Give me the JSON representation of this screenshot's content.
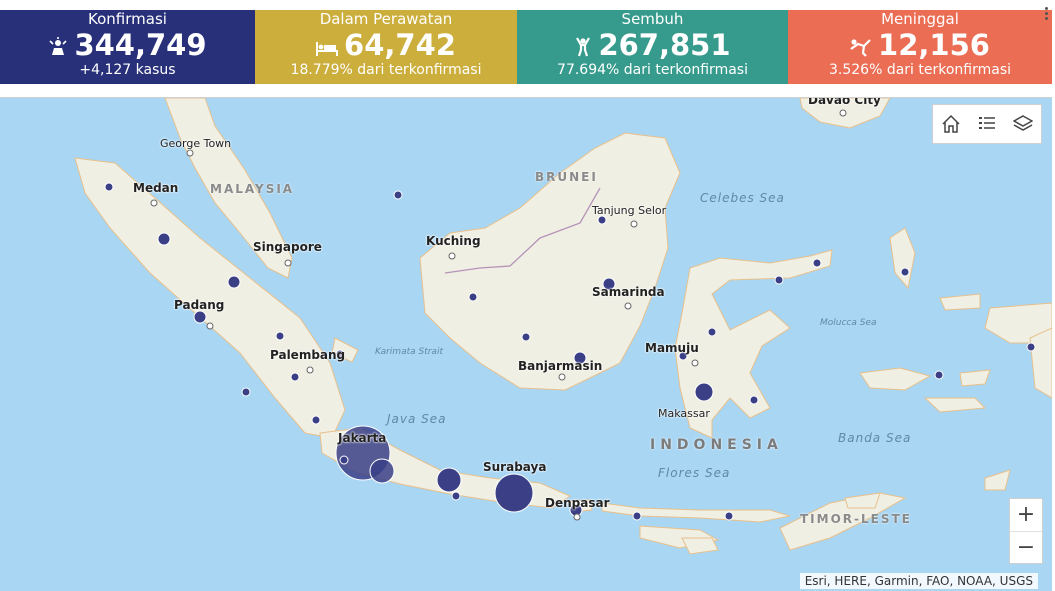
{
  "stats": [
    {
      "label": "Konfirmasi",
      "value": "344,749",
      "sub": "+4,127 kasus",
      "icon": "person-alert-icon",
      "color": "#28307a"
    },
    {
      "label": "Dalam Perawatan",
      "value": "64,742",
      "sub": "18.779% dari terkonfirmasi",
      "icon": "hospital-bed-icon",
      "color": "#ccae3c"
    },
    {
      "label": "Sembuh",
      "value": "267,851",
      "sub": "77.694% dari terkonfirmasi",
      "icon": "person-celebrate-icon",
      "color": "#369b8c"
    },
    {
      "label": "Meninggal",
      "value": "12,156",
      "sub": "3.526% dari terkonfirmasi",
      "icon": "person-falling-icon",
      "color": "#ea6d54"
    }
  ],
  "map": {
    "places": {
      "davao": "Davao City",
      "george_town": "George Town",
      "medan": "Medan",
      "singapore": "Singapore",
      "padang": "Padang",
      "palembang": "Palembang",
      "jakarta": "Jakarta",
      "kuching": "Kuching",
      "tanjung_selor": "Tanjung Selor",
      "samarinda": "Samarinda",
      "banjarmasin": "Banjarmasin",
      "mamuju": "Mamuju",
      "makassar": "Makassar",
      "surabaya": "Surabaya",
      "denpasar": "Denpasar"
    },
    "countries": {
      "malaysia": "MALAYSIA",
      "brunei": "BRUNEI",
      "indonesia": "INDONESIA",
      "timor": "TIMOR-LESTE"
    },
    "seas": {
      "celebes": "Celebes Sea",
      "java": "Java Sea",
      "karimata": "Karimata Strait",
      "molucca": "Molucca Sea",
      "banda": "Banda Sea",
      "flores": "Flores Sea"
    },
    "attribution": "Esri, HERE, Garmin, FAO, NOAA, USGS",
    "marker_color": "#3a3f86",
    "land_color": "#f0efe4",
    "water_color": "#a9d6f3",
    "toolbar": [
      "home-icon",
      "list-icon",
      "layers-icon"
    ],
    "zoom_in": "+",
    "zoom_out": "−"
  }
}
